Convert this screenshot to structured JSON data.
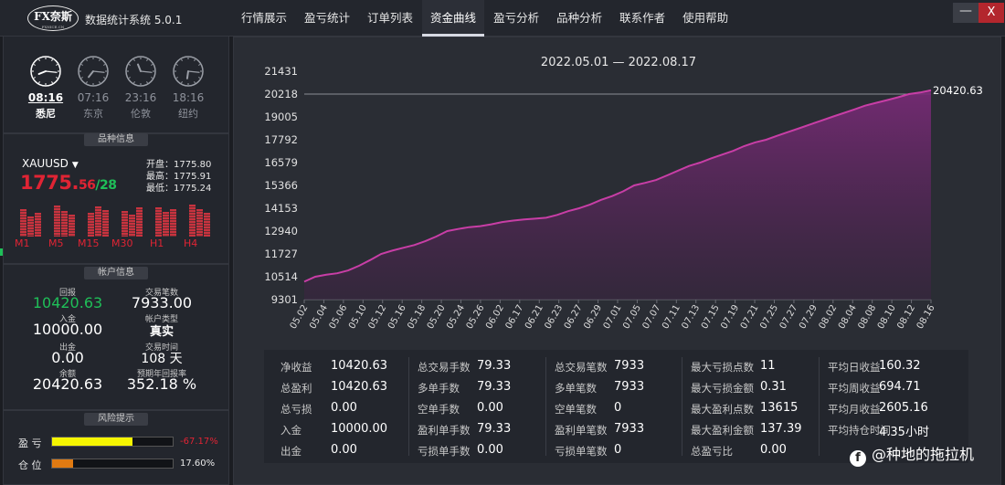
{
  "app": {
    "logo_text": "FX奈斯",
    "logo_sub": "FXNICE.CN",
    "name": "数据统计系统 5.0.1"
  },
  "nav": [
    "行情展示",
    "盈亏统计",
    "订单列表",
    "资金曲线",
    "盈亏分析",
    "品种分析",
    "联系作者",
    "使用帮助"
  ],
  "nav_active": "资金曲线",
  "window": {
    "min": "—",
    "close": "X"
  },
  "clocks": [
    {
      "time": "08:16",
      "city": "悉尼",
      "active": true,
      "hour": 8,
      "minute": 16
    },
    {
      "time": "07:16",
      "city": "东京",
      "active": false,
      "hour": 7,
      "minute": 16
    },
    {
      "time": "23:16",
      "city": "伦敦",
      "active": false,
      "hour": 23,
      "minute": 16
    },
    {
      "time": "18:16",
      "city": "纽约",
      "active": false,
      "hour": 18,
      "minute": 16
    }
  ],
  "symbol": {
    "panel_title": "品种信息",
    "name": "XAUUSD",
    "price_big": "1775.",
    "price_small": "56",
    "price_tail": "/28",
    "open": "开盘：1775.80",
    "high": "最高：1775.91",
    "low": "最低：1775.24",
    "timeframes": [
      "M1",
      "M5",
      "M15",
      "M30",
      "H1",
      "H4"
    ]
  },
  "account": {
    "panel_title": "帐户信息",
    "return_label": "回报",
    "return_value": "10420.63",
    "trades_label": "交易笔数",
    "trades_value": "7933.00",
    "deposit_label": "入金",
    "deposit_value": "10000.00",
    "type_label": "帐户类型",
    "type_value": "真实",
    "withdraw_label": "出金",
    "withdraw_value": "0.00",
    "time_label": "交易时间",
    "time_value": "108 天",
    "balance_label": "余额",
    "balance_value": "20420.63",
    "annual_label": "预期年回报率",
    "annual_value": "352.18 %"
  },
  "risk": {
    "panel_title": "风险提示",
    "pl_label": "盈 亏",
    "pl_value": "-67.17%",
    "pl_fill": 0.67,
    "pl_color": "#f5f500",
    "pos_label": "仓 位",
    "pos_value": "17.60%",
    "pos_fill": 0.176,
    "pos_color": "#e07a12"
  },
  "chart_data": {
    "type": "area",
    "title": "2022.05.01 — 2022.08.17",
    "ylim": [
      9301,
      21431
    ],
    "yticks": [
      21431,
      20218,
      19005,
      17792,
      16579,
      15366,
      14153,
      12940,
      11727,
      10514,
      9301
    ],
    "xticks": [
      "05.02",
      "05.04",
      "05.06",
      "05.10",
      "05.12",
      "05.16",
      "05.18",
      "05.20",
      "05.24",
      "05.26",
      "06.02",
      "06.17",
      "06.21",
      "06.23",
      "06.27",
      "06.29",
      "07.01",
      "07.05",
      "07.07",
      "07.11",
      "07.13",
      "07.15",
      "07.19",
      "07.21",
      "07.25",
      "07.27",
      "07.29",
      "08.02",
      "08.04",
      "08.08",
      "08.10",
      "08.12",
      "08.16"
    ],
    "last_value_label": "20420.63",
    "reference_line": 20218,
    "values": [
      10250,
      10514,
      10620,
      10700,
      10850,
      11100,
      11400,
      11727,
      11900,
      12050,
      12200,
      12400,
      12650,
      12940,
      13050,
      13150,
      13200,
      13300,
      13420,
      13500,
      13560,
      13600,
      13650,
      13800,
      14000,
      14153,
      14350,
      14600,
      14800,
      15050,
      15366,
      15500,
      15650,
      15900,
      16150,
      16400,
      16579,
      16800,
      17000,
      17200,
      17450,
      17650,
      17792,
      18000,
      18200,
      18400,
      18600,
      18800,
      19005,
      19200,
      19400,
      19600,
      19750,
      19900,
      20050,
      20218,
      20300,
      20420.63
    ],
    "line_color": "#c83ea6"
  },
  "stats": [
    [
      [
        "净收益",
        "10420.63"
      ],
      [
        "总盈利",
        "10420.63"
      ],
      [
        "总亏损",
        "0.00"
      ],
      [
        "入金",
        "10000.00"
      ],
      [
        "出金",
        "0.00"
      ]
    ],
    [
      [
        "总交易手数",
        "79.33"
      ],
      [
        "多单手数",
        "79.33"
      ],
      [
        "空单手数",
        "0.00"
      ],
      [
        "盈利单手数",
        "79.33"
      ],
      [
        "亏损单手数",
        "0.00"
      ]
    ],
    [
      [
        "总交易笔数",
        "7933"
      ],
      [
        "多单笔数",
        "7933"
      ],
      [
        "空单笔数",
        "0"
      ],
      [
        "盈利单笔数",
        "7933"
      ],
      [
        "亏损单笔数",
        "0"
      ]
    ],
    [
      [
        "最大亏损点数",
        "11"
      ],
      [
        "最大亏损金额",
        "0.31"
      ],
      [
        "最大盈利点数",
        "13615"
      ],
      [
        "最大盈利金额",
        "137.39"
      ],
      [
        "总盈亏比",
        "0.00"
      ]
    ],
    [
      [
        "平均日收益",
        "160.32"
      ],
      [
        "平均周收益",
        "694.71"
      ],
      [
        "平均月收益",
        "2605.16"
      ],
      [
        "平均持仓时间",
        "4.35小时"
      ],
      [
        "",
        ""
      ]
    ]
  ],
  "watermark": "@种地的拖拉机"
}
